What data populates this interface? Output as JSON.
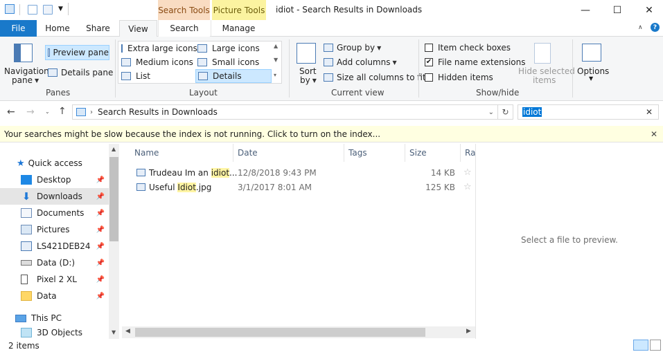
{
  "title_bar": {
    "title": "idiot - Search Results in Downloads",
    "context_search_tools": "Search Tools",
    "context_picture_tools": "Picture Tools",
    "minimize": "—",
    "maximize": "☐",
    "close": "✕"
  },
  "tabs": {
    "file": "File",
    "home": "Home",
    "share": "Share",
    "view": "View",
    "search": "Search",
    "manage": "Manage"
  },
  "ribbon": {
    "panes": {
      "navigation_pane": "Navigation",
      "navigation_pane2": "pane",
      "preview_pane": "Preview pane",
      "details_pane": "Details pane",
      "group_label": "Panes"
    },
    "layout": {
      "extra_large_icons": "Extra large icons",
      "large_icons": "Large icons",
      "medium_icons": "Medium icons",
      "small_icons": "Small icons",
      "list": "List",
      "details": "Details",
      "group_label": "Layout"
    },
    "current_view": {
      "sort_by": "Sort",
      "sort_by2": "by",
      "group_by": "Group by",
      "add_columns": "Add columns",
      "size_all_columns": "Size all columns to fit",
      "group_label": "Current view"
    },
    "show_hide": {
      "item_check_boxes": "Item check boxes",
      "item_check_boxes_checked": false,
      "file_name_extensions": "File name extensions",
      "file_name_extensions_checked": true,
      "hidden_items": "Hidden items",
      "hidden_items_checked": false,
      "hide_selected": "Hide selected",
      "hide_selected2": "items",
      "group_label": "Show/hide"
    },
    "options": "Options"
  },
  "address": {
    "path": "Search Results in Downloads",
    "search_value": "idiot"
  },
  "infobar": {
    "message": "Your searches might be slow because the index is not running.  Click to turn on the index..."
  },
  "nav": {
    "quick_access": "Quick access",
    "items": [
      {
        "label": "Desktop"
      },
      {
        "label": "Downloads"
      },
      {
        "label": "Documents"
      },
      {
        "label": "Pictures"
      },
      {
        "label": "LS421DEB24"
      },
      {
        "label": "Data (D:)"
      },
      {
        "label": "Pixel 2 XL"
      },
      {
        "label": "Data"
      }
    ],
    "this_pc": "This PC",
    "objects_3d": "3D Objects"
  },
  "columns": {
    "name": "Name",
    "date": "Date",
    "tags": "Tags",
    "size": "Size",
    "rating": "Ra"
  },
  "files": [
    {
      "name_pre": "Trudeau Im an ",
      "name_hl": "idiot",
      "name_post": "...",
      "date": "12/8/2018 9:43 PM",
      "size": "14 KB"
    },
    {
      "name_pre": "Useful ",
      "name_hl": "Idiot",
      "name_post": ".jpg",
      "date": "3/1/2017 8:01 AM",
      "size": "125 KB"
    }
  ],
  "preview": {
    "message": "Select a file to preview."
  },
  "status": {
    "items": "2 items"
  }
}
